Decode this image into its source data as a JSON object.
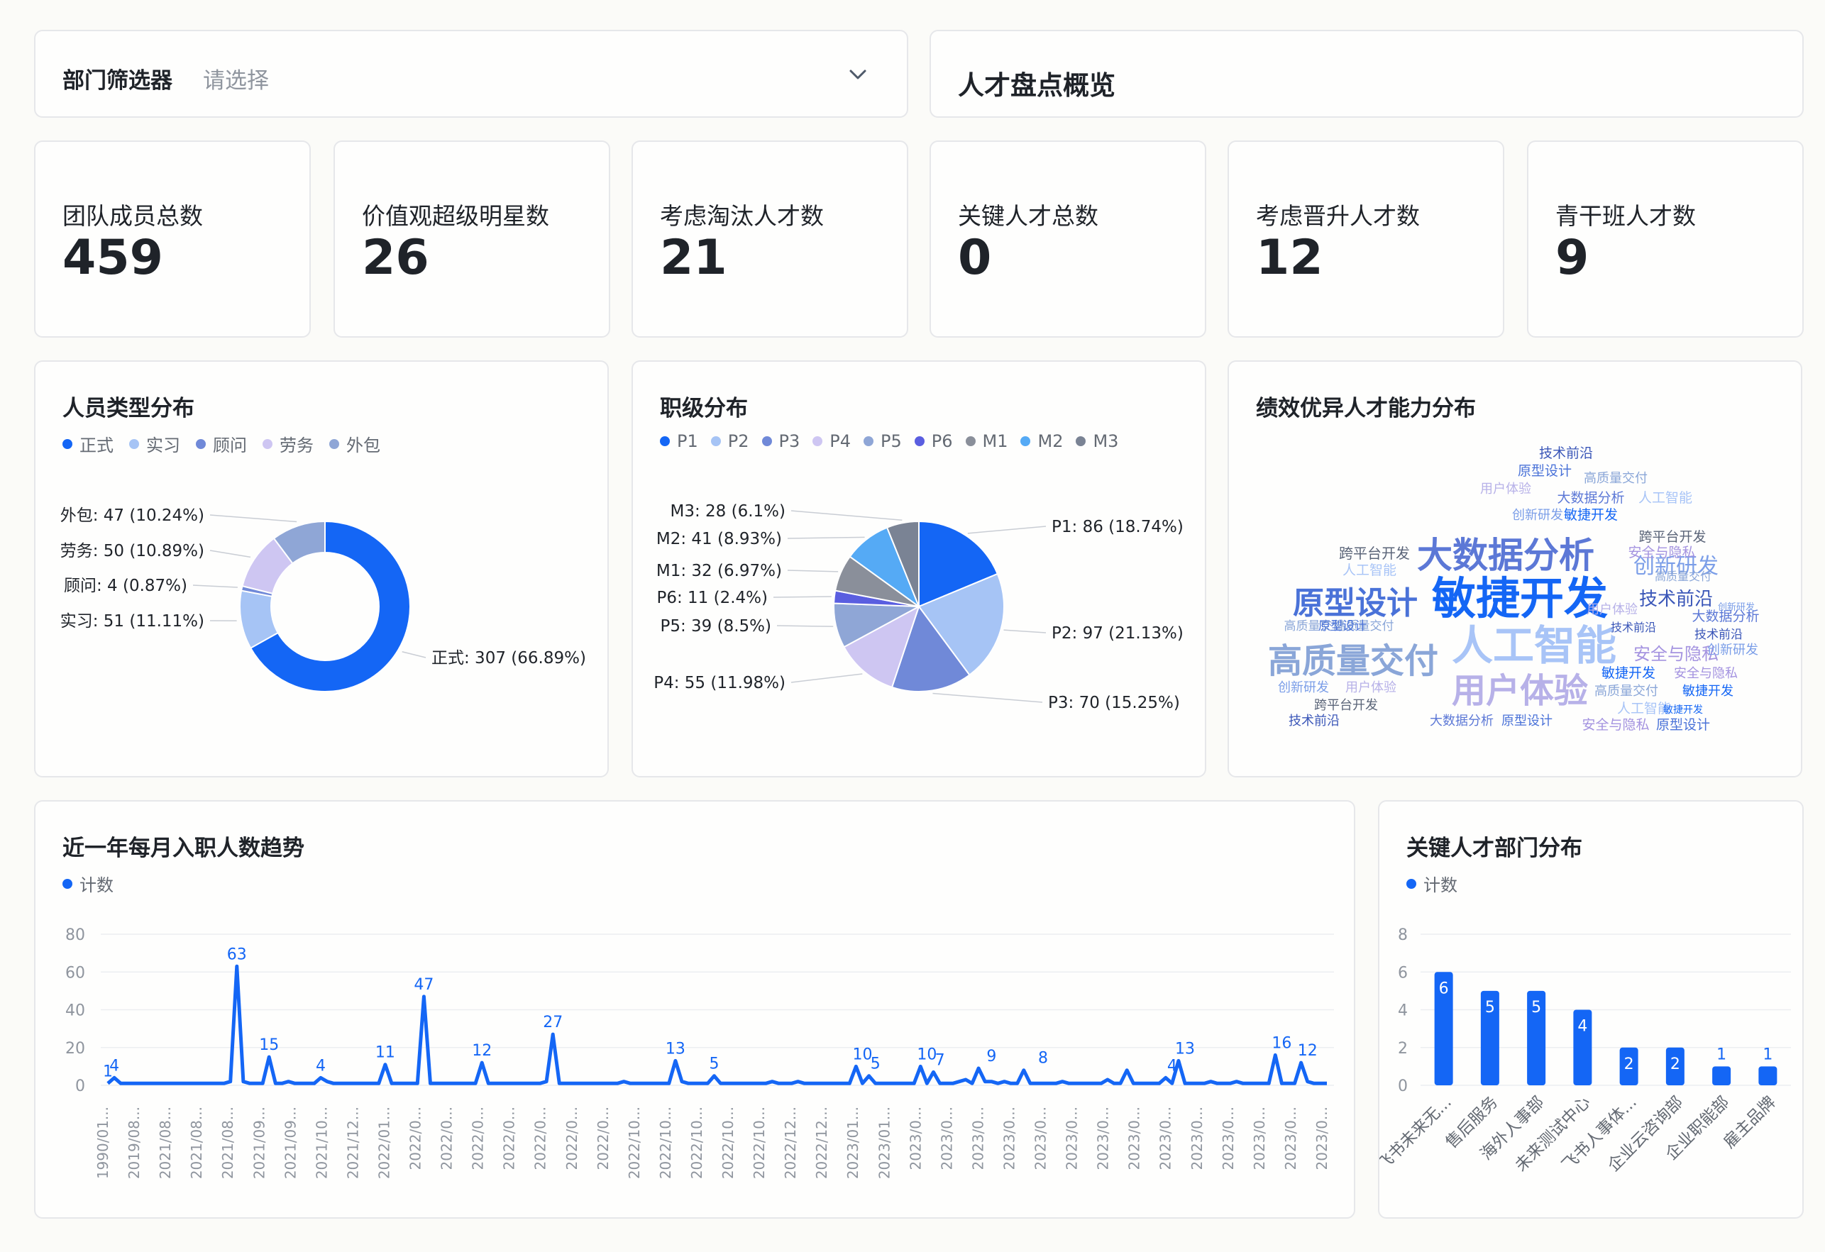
{
  "filter": {
    "label": "部门筛选器",
    "placeholder": "请选择"
  },
  "overview": {
    "title": "人才盘点概览"
  },
  "kpis": [
    {
      "label": "团队成员总数",
      "value": "459"
    },
    {
      "label": "价值观超级明星数",
      "value": "26"
    },
    {
      "label": "考虑淘汰人才数",
      "value": "21"
    },
    {
      "label": "关键人才总数",
      "value": "0"
    },
    {
      "label": "考虑晋升人才数",
      "value": "12"
    },
    {
      "label": "青干班人才数",
      "value": "9"
    }
  ],
  "colors": {
    "accent": "#1466f5",
    "border": "#e6e7ea",
    "muted": "#646a73"
  },
  "personnel_chart": {
    "title": "人员类型分布",
    "legend": [
      "正式",
      "实习",
      "顾问",
      "劳务",
      "外包"
    ]
  },
  "level_chart": {
    "title": "职级分布",
    "legend": [
      "P1",
      "P2",
      "P3",
      "P4",
      "P5",
      "P6",
      "M1",
      "M2",
      "M3"
    ]
  },
  "wordcloud": {
    "title": "绩效优异人才能力分布",
    "words": [
      {
        "text": "敏捷开发",
        "size": "xl",
        "color": "#1466f5"
      },
      {
        "text": "人工智能",
        "size": "xl",
        "color": "#a8c4f7"
      },
      {
        "text": "大数据分析",
        "size": "lg",
        "color": "#5c78d6"
      },
      {
        "text": "高质量交付",
        "size": "lg",
        "color": "#8aa6d8"
      },
      {
        "text": "原型设计",
        "size": "lg",
        "color": "#4a72d8"
      },
      {
        "text": "用户体验",
        "size": "lg",
        "color": "#b7b1e8"
      },
      {
        "text": "创新研发",
        "size": "md",
        "color": "#7b9ee8"
      },
      {
        "text": "技术前沿",
        "size": "md",
        "color": "#3a56b8"
      },
      {
        "text": "安全与隐私",
        "size": "md",
        "color": "#a493e0"
      },
      {
        "text": "跨平台开发",
        "size": "sm",
        "color": "#5a6478"
      }
    ]
  },
  "chart_data": [
    {
      "type": "pie",
      "title": "人员类型分布",
      "variant": "donut",
      "legend_position": "top-left",
      "slices": [
        {
          "name": "正式",
          "value": 307,
          "percent": "66.89%",
          "color": "#1466f5",
          "label": "正式: 307 (66.89%)"
        },
        {
          "name": "实习",
          "value": 51,
          "percent": "11.11%",
          "color": "#a6c4f5",
          "label": "实习: 51 (11.11%)"
        },
        {
          "name": "顾问",
          "value": 4,
          "percent": "0.87%",
          "color": "#7089d8",
          "label": "顾问: 4 (0.87%)"
        },
        {
          "name": "劳务",
          "value": 50,
          "percent": "10.89%",
          "color": "#cec6f2",
          "label": "劳务: 50 (10.89%)"
        },
        {
          "name": "外包",
          "value": 47,
          "percent": "10.24%",
          "color": "#8fa6d6",
          "label": "外包: 47 (10.24%)"
        }
      ]
    },
    {
      "type": "pie",
      "title": "职级分布",
      "legend_position": "top-left",
      "slices": [
        {
          "name": "P1",
          "value": 86,
          "percent": "18.74%",
          "color": "#1466f5",
          "label": "P1: 86 (18.74%)"
        },
        {
          "name": "P2",
          "value": 97,
          "percent": "21.13%",
          "color": "#a6c4f5",
          "label": "P2: 97 (21.13%)"
        },
        {
          "name": "P3",
          "value": 70,
          "percent": "15.25%",
          "color": "#7089d8",
          "label": "P3: 70 (15.25%)"
        },
        {
          "name": "P4",
          "value": 55,
          "percent": "11.98%",
          "color": "#cec6f2",
          "label": "P4: 55 (11.98%)"
        },
        {
          "name": "P5",
          "value": 39,
          "percent": "8.5%",
          "color": "#8fa6d6",
          "label": "P5: 39 (8.5%)"
        },
        {
          "name": "P6",
          "value": 11,
          "percent": "2.4%",
          "color": "#5a5ee0",
          "label": "P6: 11 (2.4%)"
        },
        {
          "name": "M1",
          "value": 32,
          "percent": "6.97%",
          "color": "#8a8f9a",
          "label": "M1: 32 (6.97%)"
        },
        {
          "name": "M2",
          "value": 41,
          "percent": "8.93%",
          "color": "#55aaf5",
          "label": "M2: 41 (8.93%)"
        },
        {
          "name": "M3",
          "value": 28,
          "percent": "6.1%",
          "color": "#7a8394",
          "label": "M3: 28 (6.1%)"
        }
      ]
    },
    {
      "type": "line",
      "title": "近一年每月入职人数趋势",
      "legend": [
        "计数"
      ],
      "series": [
        {
          "name": "计数",
          "color": "#1466f5"
        }
      ],
      "ylim": [
        0,
        80
      ],
      "yticks": [
        0,
        20,
        40,
        60,
        80
      ],
      "xticks": [
        "1990/01...",
        "2019/08...",
        "2021/08...",
        "2021/08...",
        "2021/08...",
        "2021/09...",
        "2021/09...",
        "2021/10...",
        "2021/12...",
        "2022/01...",
        "2022/0...",
        "2022/0...",
        "2022/0...",
        "2022/0...",
        "2022/0...",
        "2022/0...",
        "2022/0...",
        "2022/10...",
        "2022/10...",
        "2022/10...",
        "2022/10...",
        "2022/10...",
        "2022/12...",
        "2022/12...",
        "2023/01...",
        "2023/01...",
        "2023/0...",
        "2023/0...",
        "2023/0...",
        "2023/0...",
        "2023/0...",
        "2023/0...",
        "2023/0...",
        "2023/0...",
        "2023/0...",
        "2023/0...",
        "2023/0...",
        "2023/0...",
        "2023/0...",
        "2023/0..."
      ],
      "values": [
        1,
        4,
        1,
        1,
        1,
        1,
        1,
        1,
        1,
        1,
        1,
        1,
        1,
        1,
        1,
        1,
        1,
        1,
        1,
        2,
        63,
        2,
        1,
        1,
        1,
        15,
        1,
        1,
        2,
        1,
        1,
        1,
        1,
        4,
        2,
        1,
        1,
        1,
        1,
        1,
        1,
        1,
        1,
        11,
        1,
        1,
        1,
        1,
        1,
        47,
        1,
        1,
        1,
        1,
        1,
        1,
        1,
        1,
        12,
        1,
        1,
        1,
        1,
        1,
        1,
        1,
        1,
        1,
        2,
        27,
        1,
        1,
        1,
        1,
        1,
        1,
        1,
        1,
        1,
        1,
        2,
        1,
        1,
        1,
        1,
        1,
        1,
        1,
        13,
        2,
        1,
        1,
        1,
        1,
        5,
        1,
        1,
        1,
        1,
        1,
        1,
        1,
        1,
        2,
        1,
        1,
        1,
        2,
        1,
        1,
        1,
        1,
        1,
        1,
        1,
        1,
        10,
        1,
        5,
        1,
        1,
        1,
        1,
        1,
        1,
        1,
        10,
        1,
        7,
        1,
        1,
        1,
        2,
        3,
        1,
        9,
        2,
        2,
        1,
        2,
        1,
        1,
        8,
        1,
        1,
        1,
        1,
        1,
        2,
        1,
        1,
        1,
        1,
        1,
        1,
        3,
        1,
        1,
        8,
        1,
        1,
        1,
        1,
        1,
        4,
        1,
        13,
        1,
        1,
        1,
        1,
        2,
        1,
        1,
        1,
        2,
        1,
        1,
        1,
        1,
        1,
        16,
        1,
        1,
        1,
        12,
        2,
        1,
        1,
        1
      ],
      "labeled_points": [
        {
          "i": 0,
          "v": 1
        },
        {
          "i": 1,
          "v": 4
        },
        {
          "i": 20,
          "v": 63
        },
        {
          "i": 25,
          "v": 15
        },
        {
          "i": 33,
          "v": 4
        },
        {
          "i": 43,
          "v": 11
        },
        {
          "i": 49,
          "v": 47
        },
        {
          "i": 58,
          "v": 12
        },
        {
          "i": 69,
          "v": 27
        },
        {
          "i": 88,
          "v": 13
        },
        {
          "i": 94,
          "v": 5
        },
        {
          "i": 117,
          "v": 10
        },
        {
          "i": 119,
          "v": 5
        },
        {
          "i": 127,
          "v": 10
        },
        {
          "i": 129,
          "v": 7
        },
        {
          "i": 137,
          "v": 9
        },
        {
          "i": 145,
          "v": 8
        },
        {
          "i": 165,
          "v": 4
        },
        {
          "i": 167,
          "v": 13
        },
        {
          "i": 182,
          "v": 16
        },
        {
          "i": 186,
          "v": 12
        }
      ]
    },
    {
      "type": "bar",
      "title": "关键人才部门分布",
      "legend": [
        "计数"
      ],
      "series": [
        {
          "name": "计数",
          "color": "#1466f5"
        }
      ],
      "categories": [
        "飞书未来无...",
        "售后服务",
        "海外人事部",
        "未来测试中心",
        "飞书人事体...",
        "企业云咨询部",
        "企业职能部",
        "雇主品牌"
      ],
      "values": [
        6,
        5,
        5,
        4,
        2,
        2,
        1,
        1
      ],
      "ylim": [
        0,
        8
      ],
      "yticks": [
        0,
        2,
        4,
        6,
        8
      ]
    }
  ]
}
